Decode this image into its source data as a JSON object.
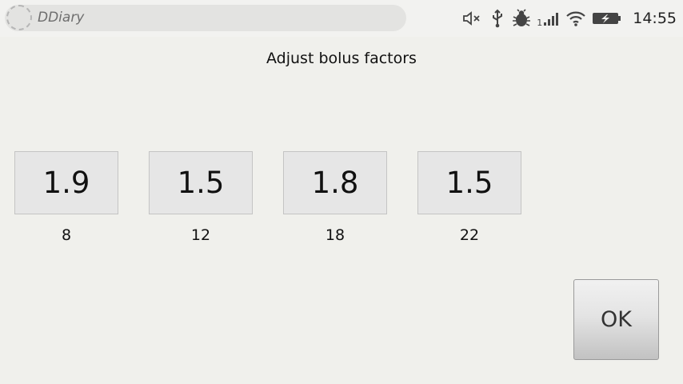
{
  "statusbar": {
    "app_name": "DDiary",
    "clock": "14:55",
    "signal_sim": "1",
    "icons": [
      "mute-icon",
      "usb-icon",
      "debug-bug-icon",
      "signal-icon",
      "wifi-icon",
      "battery-charging-icon"
    ]
  },
  "screen": {
    "title": "Adjust bolus factors"
  },
  "factors": [
    {
      "value": "1.9",
      "hour": "8"
    },
    {
      "value": "1.5",
      "hour": "12"
    },
    {
      "value": "1.8",
      "hour": "18"
    },
    {
      "value": "1.5",
      "hour": "22"
    }
  ],
  "ok_label": "OK"
}
